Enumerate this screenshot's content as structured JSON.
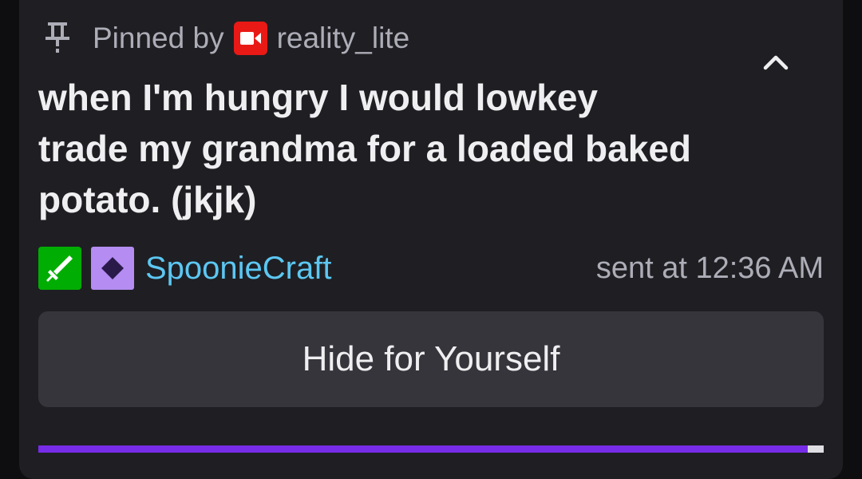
{
  "pin": {
    "pinned_by_label": "Pinned by",
    "pinner_name": "reality_lite",
    "pinner_badge_color": "#e91916",
    "pin_icon": "pin-icon"
  },
  "message": {
    "text": "when I'm hungry I would lowkey trade my grandma for a loaded baked potato. (jkjk)"
  },
  "author": {
    "name": "SpoonieCraft",
    "name_color": "#5cc7f2",
    "badges": [
      "sword-badge-icon",
      "subscriber-badge-icon"
    ],
    "sent_at": "sent at 12:36 AM"
  },
  "actions": {
    "hide_label": "Hide for Yourself"
  },
  "progress": {
    "fraction": 0.98,
    "color": "#772ce8"
  }
}
